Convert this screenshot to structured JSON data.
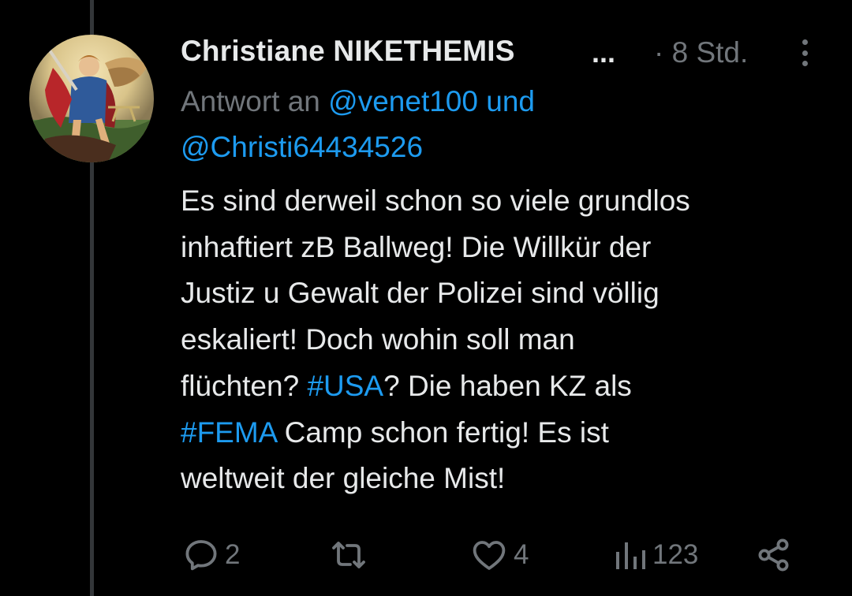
{
  "tweet": {
    "display_name": "Christiane NIKETHEMIS",
    "name_truncation": "...",
    "timestamp": "· 8 Std.",
    "reply_prefix": "Antwort an",
    "reply_mentions": [
      "@venet100 und",
      "@Christi64434526"
    ],
    "text_lines": [
      {
        "parts": [
          {
            "text": "Es sind derweil schon so viele grundlos",
            "hashtag": false
          }
        ]
      },
      {
        "parts": [
          {
            "text": "inhaftiert zB Ballweg! Die Willkür der",
            "hashtag": false
          }
        ]
      },
      {
        "parts": [
          {
            "text": "Justiz u Gewalt der Polizei sind völlig",
            "hashtag": false
          }
        ]
      },
      {
        "parts": [
          {
            "text": "eskaliert! Doch wohin soll man",
            "hashtag": false
          }
        ]
      },
      {
        "parts": [
          {
            "text": "flüchten? ",
            "hashtag": false
          },
          {
            "text": "#USA",
            "hashtag": true
          },
          {
            "text": "? Die haben KZ als",
            "hashtag": false
          }
        ]
      },
      {
        "parts": [
          {
            "text": "#FEMA",
            "hashtag": true
          },
          {
            "text": " Camp schon fertig! Es ist",
            "hashtag": false
          }
        ]
      },
      {
        "parts": [
          {
            "text": "weltweit der gleiche Mist!",
            "hashtag": false
          }
        ]
      }
    ]
  },
  "actions": {
    "reply_count": "2",
    "retweet_count": "",
    "like_count": "4",
    "views_count": "123"
  },
  "icons": {
    "avatar": "avatar-image",
    "more": "more-icon",
    "reply": "reply-icon",
    "retweet": "retweet-icon",
    "like": "heart-icon",
    "views": "views-icon",
    "share": "share-icon"
  },
  "colors": {
    "background": "#000000",
    "text_primary": "#e7e9ea",
    "text_secondary": "#71767b",
    "link": "#1d9bf0",
    "thread_line": "#333639"
  }
}
